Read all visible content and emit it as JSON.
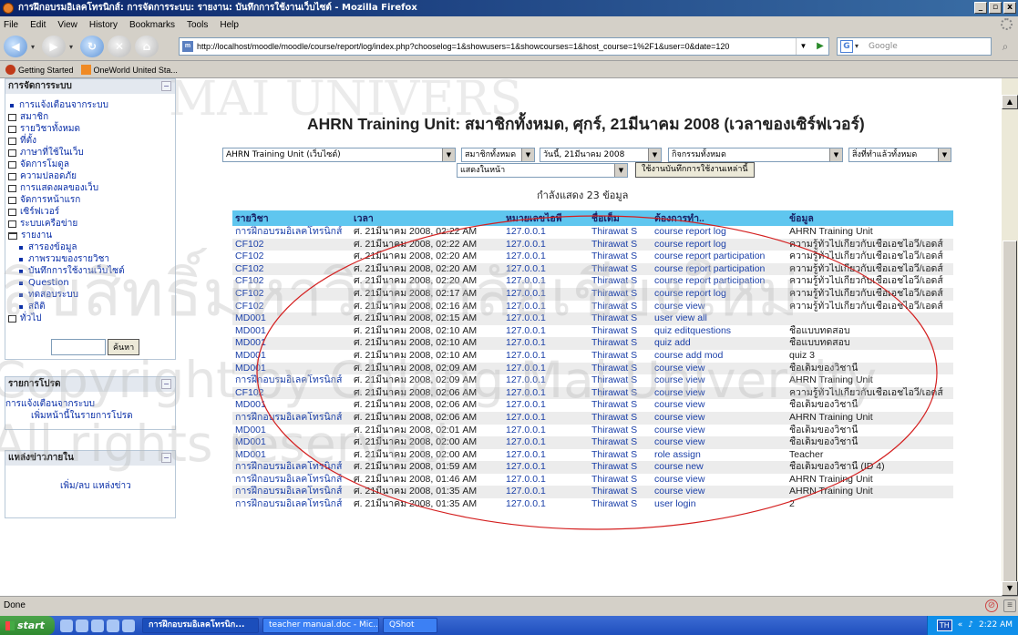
{
  "window": {
    "title": "การฝึกอบรมอิเลคโทรนิกส์: การจัดการระบบ: รายงาน: บันทึกการใช้งานเว็บไซต์ - Mozilla Firefox",
    "controls": [
      "_",
      "▫",
      "x"
    ]
  },
  "menu": [
    "File",
    "Edit",
    "View",
    "History",
    "Bookmarks",
    "Tools",
    "Help"
  ],
  "nav": {
    "url": "http://localhost/moodle/moodle/course/report/log/index.php?chooselog=1&showusers=1&showcourses=1&host_course=1%2F1&user=0&date=120",
    "search_placeholder": "Google"
  },
  "bookmarks": [
    "Getting Started",
    "OneWorld United Sta..."
  ],
  "admin_block": {
    "title": "การจัดการระบบ",
    "items": [
      {
        "label": "การแจ้งเตือนจากระบบ",
        "icon": "bullet",
        "sub": false
      },
      {
        "label": "สมาชิก",
        "icon": "box",
        "sub": false
      },
      {
        "label": "รายวิชาทั้งหมด",
        "icon": "box",
        "sub": false
      },
      {
        "label": "ที่ตั้ง",
        "icon": "box",
        "sub": false
      },
      {
        "label": "ภาษาที่ใช้ในเว็บ",
        "icon": "box",
        "sub": false
      },
      {
        "label": "จัดการโมดูล",
        "icon": "box",
        "sub": false
      },
      {
        "label": "ความปลอดภัย",
        "icon": "box",
        "sub": false
      },
      {
        "label": "การแสดงผลของเว็บ",
        "icon": "box",
        "sub": false
      },
      {
        "label": "จัดการหน้าแรก",
        "icon": "box",
        "sub": false
      },
      {
        "label": "เซิร์ฟเวอร์",
        "icon": "box",
        "sub": false
      },
      {
        "label": "ระบบเครือข่าย",
        "icon": "box",
        "sub": false
      },
      {
        "label": "รายงาน",
        "icon": "folder",
        "sub": false
      },
      {
        "label": "สารองข้อมูล",
        "icon": "bullet",
        "sub": true
      },
      {
        "label": "ภาพรวมของรายวิชา",
        "icon": "bullet",
        "sub": true
      },
      {
        "label": "บันทึกการใช้งานเว็บไซต์",
        "icon": "bullet",
        "sub": true
      },
      {
        "label": "Question",
        "icon": "bullet",
        "sub": true
      },
      {
        "label": "ทดสอบระบบ",
        "icon": "bullet",
        "sub": true
      },
      {
        "label": "สถิติ",
        "icon": "bullet",
        "sub": true
      },
      {
        "label": "ทั่วไป",
        "icon": "box",
        "sub": false
      }
    ],
    "search_button": "ค้นหา"
  },
  "fav_block": {
    "title": "รายการโปรด",
    "line1": "การแจ้งเตือนจากระบบ",
    "line2": "เพิ่มหน้านี้ในรายการโปรด"
  },
  "news_block": {
    "title": "แหล่งข่าวภายใน",
    "link": "เพิ่ม/ลบ แหล่งข่าว"
  },
  "page": {
    "title": "AHRN Training Unit: สมาชิกทั้งหมด, ศุกร์, 21มีนาคม 2008 (เวลาของเซิร์ฟเวอร์)",
    "showing": "กำลังแสดง 23 ข้อมูล"
  },
  "filters": {
    "course": "AHRN Training Unit (เว็บไซต์)",
    "users": "สมาชิกทั้งหมด",
    "date": "วันนี้, 21มีนาคม 2008",
    "activities": "กิจกรรมทั้งหมด",
    "actions": "สิ่งที่ทำแล้วทั้งหมด",
    "display": "แสดงในหน้า",
    "button": "ใช้งานบันทึกการใช้งานเหล่านี้"
  },
  "log_table": {
    "headers": [
      "รายวิชา",
      "เวลา",
      "หมายเลขไอพี",
      "ชื่อเต็ม",
      "ต้องการทำ..",
      "ข้อมูล"
    ],
    "rows": [
      [
        "การฝึกอบรมอิเลคโทรนิกส์",
        "ศ. 21มีนาคม 2008, 02:22 AM",
        "127.0.0.1",
        "Thirawat S",
        "course report log",
        "AHRN Training Unit"
      ],
      [
        "CF102",
        "ศ. 21มีนาคม 2008, 02:22 AM",
        "127.0.0.1",
        "Thirawat S",
        "course report log",
        "ความรู้ทั่วไปเกี่ยวกับเชื้อเอชไอวี/เอดส์"
      ],
      [
        "CF102",
        "ศ. 21มีนาคม 2008, 02:20 AM",
        "127.0.0.1",
        "Thirawat S",
        "course report participation",
        "ความรู้ทั่วไปเกี่ยวกับเชื้อเอชไอวี/เอดส์"
      ],
      [
        "CF102",
        "ศ. 21มีนาคม 2008, 02:20 AM",
        "127.0.0.1",
        "Thirawat S",
        "course report participation",
        "ความรู้ทั่วไปเกี่ยวกับเชื้อเอชไอวี/เอดส์"
      ],
      [
        "CF102",
        "ศ. 21มีนาคม 2008, 02:20 AM",
        "127.0.0.1",
        "Thirawat S",
        "course report participation",
        "ความรู้ทั่วไปเกี่ยวกับเชื้อเอชไอวี/เอดส์"
      ],
      [
        "CF102",
        "ศ. 21มีนาคม 2008, 02:17 AM",
        "127.0.0.1",
        "Thirawat S",
        "course report log",
        "ความรู้ทั่วไปเกี่ยวกับเชื้อเอชไอวี/เอดส์"
      ],
      [
        "CF102",
        "ศ. 21มีนาคม 2008, 02:16 AM",
        "127.0.0.1",
        "Thirawat S",
        "course view",
        "ความรู้ทั่วไปเกี่ยวกับเชื้อเอชไอวี/เอดส์"
      ],
      [
        "MD001",
        "ศ. 21มีนาคม 2008, 02:15 AM",
        "127.0.0.1",
        "Thirawat S",
        "user view all",
        ""
      ],
      [
        "MD001",
        "ศ. 21มีนาคม 2008, 02:10 AM",
        "127.0.0.1",
        "Thirawat S",
        "quiz editquestions",
        "ชื่อแบบทดสอบ"
      ],
      [
        "MD001",
        "ศ. 21มีนาคม 2008, 02:10 AM",
        "127.0.0.1",
        "Thirawat S",
        "quiz add",
        "ชื่อแบบทดสอบ"
      ],
      [
        "MD001",
        "ศ. 21มีนาคม 2008, 02:10 AM",
        "127.0.0.1",
        "Thirawat S",
        "course add mod",
        "quiz 3"
      ],
      [
        "MD001",
        "ศ. 21มีนาคม 2008, 02:09 AM",
        "127.0.0.1",
        "Thirawat S",
        "course view",
        "ชื่อเต็มของวิชานี้"
      ],
      [
        "การฝึกอบรมอิเลคโทรนิกส์",
        "ศ. 21มีนาคม 2008, 02:09 AM",
        "127.0.0.1",
        "Thirawat S",
        "course view",
        "AHRN Training Unit"
      ],
      [
        "CF102",
        "ศ. 21มีนาคม 2008, 02:06 AM",
        "127.0.0.1",
        "Thirawat S",
        "course view",
        "ความรู้ทั่วไปเกี่ยวกับเชื้อเอชไอวี/เอดส์"
      ],
      [
        "MD001",
        "ศ. 21มีนาคม 2008, 02:06 AM",
        "127.0.0.1",
        "Thirawat S",
        "course view",
        "ชื่อเต็มของวิชานี้"
      ],
      [
        "การฝึกอบรมอิเลคโทรนิกส์",
        "ศ. 21มีนาคม 2008, 02:06 AM",
        "127.0.0.1",
        "Thirawat S",
        "course view",
        "AHRN Training Unit"
      ],
      [
        "MD001",
        "ศ. 21มีนาคม 2008, 02:01 AM",
        "127.0.0.1",
        "Thirawat S",
        "course view",
        "ชื่อเต็มของวิชานี้"
      ],
      [
        "MD001",
        "ศ. 21มีนาคม 2008, 02:00 AM",
        "127.0.0.1",
        "Thirawat S",
        "course view",
        "ชื่อเต็มของวิชานี้"
      ],
      [
        "MD001",
        "ศ. 21มีนาคม 2008, 02:00 AM",
        "127.0.0.1",
        "Thirawat S",
        "role assign",
        "Teacher"
      ],
      [
        "การฝึกอบรมอิเลคโทรนิกส์",
        "ศ. 21มีนาคม 2008, 01:59 AM",
        "127.0.0.1",
        "Thirawat S",
        "course new",
        "ชื่อเต็มของวิชานี้ (ID 4)"
      ],
      [
        "การฝึกอบรมอิเลคโทรนิกส์",
        "ศ. 21มีนาคม 2008, 01:46 AM",
        "127.0.0.1",
        "Thirawat S",
        "course view",
        "AHRN Training Unit"
      ],
      [
        "การฝึกอบรมอิเลคโทรนิกส์",
        "ศ. 21มีนาคม 2008, 01:35 AM",
        "127.0.0.1",
        "Thirawat S",
        "course view",
        "AHRN Training Unit"
      ],
      [
        "การฝึกอบรมอิเลคโทรนิกส์",
        "ศ. 21มีนาคม 2008, 01:35 AM",
        "127.0.0.1",
        "Thirawat S",
        "user login",
        "2"
      ]
    ]
  },
  "status": {
    "text": "Done"
  },
  "taskbar": {
    "start": "start",
    "tasks": [
      "การฝึกอบรมอิเลคโทรนิก...",
      "teacher manual.doc - Mic...",
      "QShot"
    ],
    "lang": "TH",
    "clock": "2:22 AM"
  },
  "watermark": [
    "MAI UNIVERS",
    "ลิขสิทธิ์มหาวิทยาลัยเชียงใหม่",
    "Copyright by Chiang Mai University",
    "All rights reserved"
  ],
  "colors": {
    "table_header": "#5fc6ef",
    "link": "#1a3fa8",
    "annotation": "#d42020"
  }
}
